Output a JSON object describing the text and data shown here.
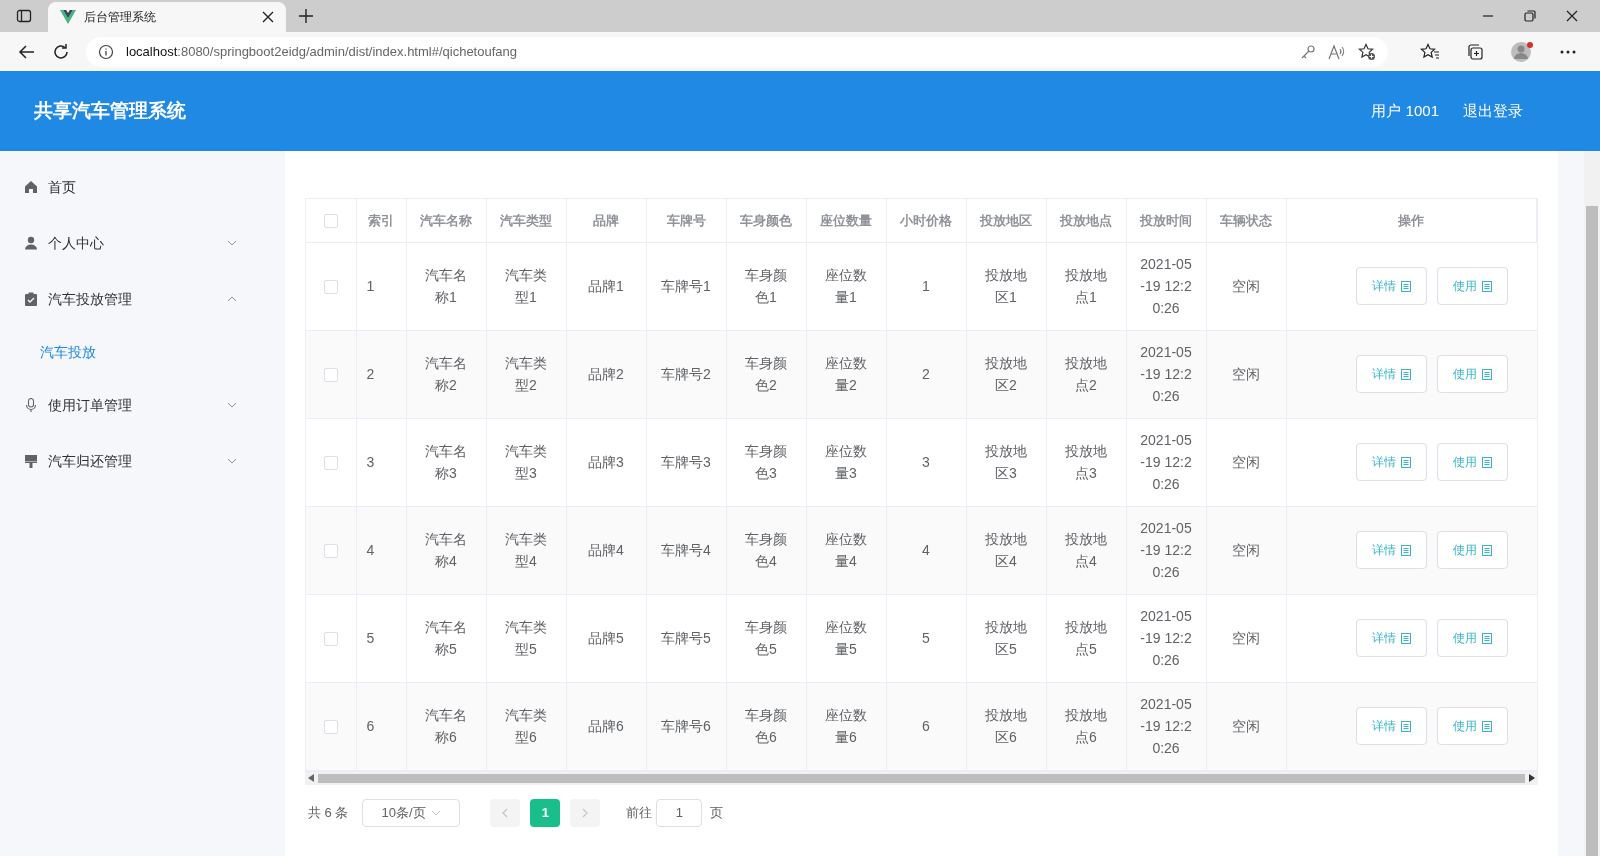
{
  "browser": {
    "tab_title": "后台管理系统",
    "url_host": "localhost",
    "url_path": ":8080/springboot2eidg/admin/dist/index.html#/qichetoufang"
  },
  "header": {
    "title": "共享汽车管理系统",
    "user": "用户 1001",
    "logout": "退出登录"
  },
  "sidebar": {
    "items": [
      {
        "label": "首页",
        "kind": "home"
      },
      {
        "label": "个人中心",
        "kind": "user",
        "expanded": false
      },
      {
        "label": "汽车投放管理",
        "kind": "clipboard",
        "expanded": true,
        "children": [
          {
            "label": "汽车投放",
            "selected": true
          }
        ]
      },
      {
        "label": "使用订单管理",
        "kind": "mic",
        "expanded": false
      },
      {
        "label": "汽车归还管理",
        "kind": "brush",
        "expanded": false
      }
    ]
  },
  "table": {
    "header_checked": false,
    "columns": [
      "索引",
      "汽车名称",
      "汽车类型",
      "品牌",
      "车牌号",
      "车身颜色",
      "座位数量",
      "小时价格",
      "投放地区",
      "投放地点",
      "投放时间",
      "车辆状态",
      "操作"
    ],
    "rows": [
      {
        "checked": false,
        "cells": [
          "1",
          "汽车名称1",
          "汽车类型1",
          "品牌1",
          "车牌号1",
          "车身颜色1",
          "座位数量1",
          "1",
          "投放地区1",
          "投放地点1",
          "2021-05-19 12:20:26",
          "空闲"
        ],
        "actions": [
          "详情",
          "使用"
        ]
      },
      {
        "checked": false,
        "cells": [
          "2",
          "汽车名称2",
          "汽车类型2",
          "品牌2",
          "车牌号2",
          "车身颜色2",
          "座位数量2",
          "2",
          "投放地区2",
          "投放地点2",
          "2021-05-19 12:20:26",
          "空闲"
        ],
        "actions": [
          "详情",
          "使用"
        ]
      },
      {
        "checked": false,
        "cells": [
          "3",
          "汽车名称3",
          "汽车类型3",
          "品牌3",
          "车牌号3",
          "车身颜色3",
          "座位数量3",
          "3",
          "投放地区3",
          "投放地点3",
          "2021-05-19 12:20:26",
          "空闲"
        ],
        "actions": [
          "详情",
          "使用"
        ]
      },
      {
        "checked": false,
        "cells": [
          "4",
          "汽车名称4",
          "汽车类型4",
          "品牌4",
          "车牌号4",
          "车身颜色4",
          "座位数量4",
          "4",
          "投放地区4",
          "投放地点4",
          "2021-05-19 12:20:26",
          "空闲"
        ],
        "actions": [
          "详情",
          "使用"
        ]
      },
      {
        "checked": false,
        "cells": [
          "5",
          "汽车名称5",
          "汽车类型5",
          "品牌5",
          "车牌号5",
          "车身颜色5",
          "座位数量5",
          "5",
          "投放地区5",
          "投放地点5",
          "2021-05-19 12:20:26",
          "空闲"
        ],
        "actions": [
          "详情",
          "使用"
        ]
      },
      {
        "checked": false,
        "cells": [
          "6",
          "汽车名称6",
          "汽车类型6",
          "品牌6",
          "车牌号6",
          "车身颜色6",
          "座位数量6",
          "6",
          "投放地区6",
          "投放地点6",
          "2021-05-19 12:20:26",
          "空闲"
        ],
        "actions": [
          "详情",
          "使用"
        ]
      }
    ]
  },
  "pagination": {
    "total": "共 6 条",
    "page_size": "10条/页",
    "pages": [
      {
        "label": "1",
        "selected": true
      }
    ],
    "goto_label": "前往",
    "goto_value": "1",
    "page_unit": "页"
  }
}
